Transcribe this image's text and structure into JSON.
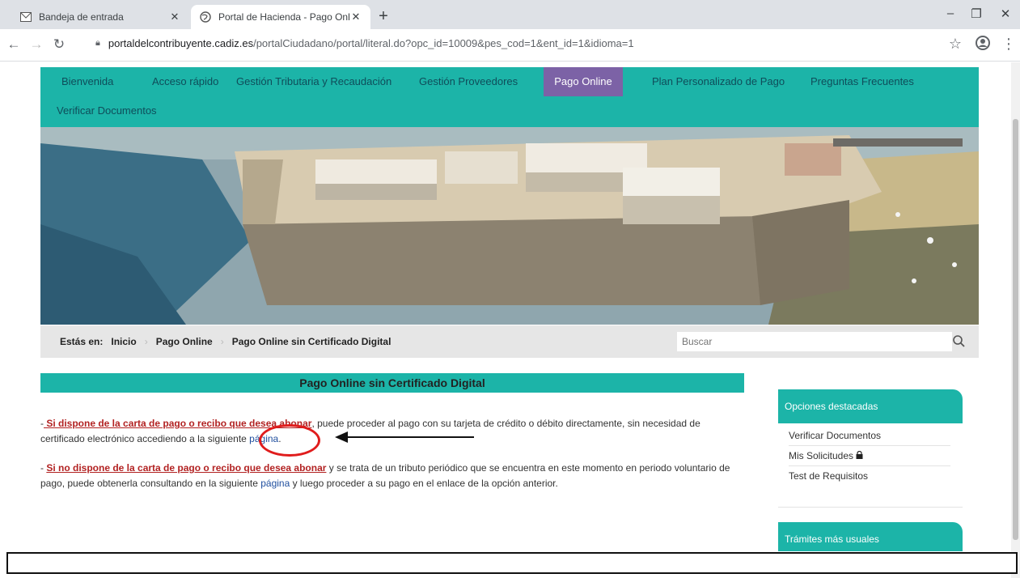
{
  "browser": {
    "tabs": [
      {
        "title": "Bandeja de entrada",
        "icon": "mail-icon",
        "active": false
      },
      {
        "title": "Portal de Hacienda - Pago Online",
        "icon": "globe-icon",
        "active": true
      }
    ],
    "url_host": "portaldelcontribuyente.cadiz.es",
    "url_path": "/portalCiudadano/portal/literal.do?opc_id=10009&pes_cod=1&ent_id=1&idioma=1"
  },
  "nav": {
    "items": [
      "Bienvenida",
      "Acceso rápido",
      "Gestión Tributaria y Recaudación",
      "Gestión Proveedores",
      "Pago Online",
      "Plan Personalizado de Pago",
      "Preguntas Frecuentes",
      "Verificar Documentos"
    ],
    "active_item": "Pago Online"
  },
  "breadcrumb": {
    "prefix": "Estás en:",
    "items": [
      "Inicio",
      "Pago Online",
      "Pago Online sin Certificado Digital"
    ]
  },
  "search": {
    "placeholder": "Buscar"
  },
  "content": {
    "title": "Pago Online sin Certificado Digital",
    "p1_dash": "-",
    "p1_link": " Si dispone de la carta de pago o recibo que desea abonar",
    "p1_text": ", puede proceder al pago con su tarjeta de crédito o débito directamente, sin necesidad de certificado electrónico accediendo a la siguiente ",
    "p1_page_link": "página",
    "p1_end": ".",
    "p2_dash": "- ",
    "p2_link": "Si no dispone de la carta de pago o recibo que desea abonar",
    "p2_text": "  y se trata de un tributo periódico que se encuentra en este momento en periodo voluntario de pago, puede obtenerla consultando en la siguiente ",
    "p2_page_link": "página",
    "p2_end": " y luego proceder a su pago en el enlace de la opción anterior."
  },
  "sidebar": {
    "featured_title": "Opciones destacadas",
    "featured_items": [
      "Verificar Documentos",
      "Mis Solicitudes",
      "Test de Requisitos"
    ],
    "common_title": "Trámites más usuales"
  },
  "colors": {
    "teal": "#1cb4a8",
    "nav_active": "#7c62a6",
    "annotation_red": "#e01c1c"
  }
}
